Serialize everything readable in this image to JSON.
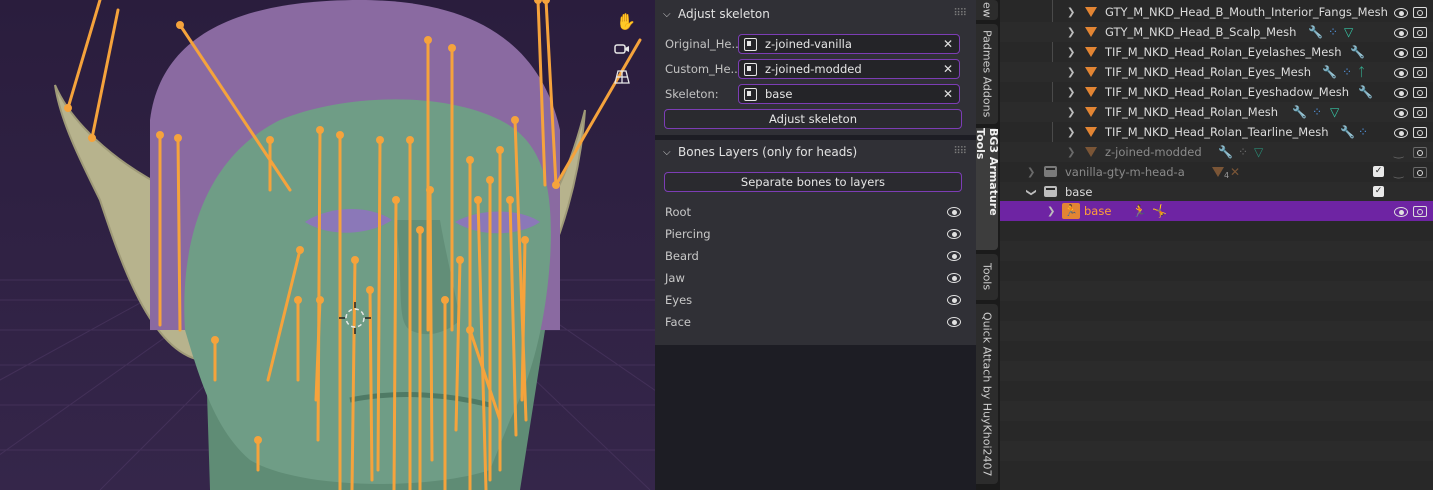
{
  "viewport": {
    "tools": [
      "hand-icon",
      "camera-icon",
      "grid-icon"
    ]
  },
  "npanel": {
    "adjust_skeleton": {
      "title": "Adjust skeleton",
      "original_label": "Original_He...",
      "original_value": "z-joined-vanilla",
      "custom_label": "Custom_He...",
      "custom_value": "z-joined-modded",
      "skeleton_label": "Skeleton:",
      "skeleton_value": "base",
      "button": "Adjust skeleton"
    },
    "bones_layers": {
      "title": "Bones Layers (only for heads)",
      "button": "Separate bones to layers",
      "layers": [
        "Root",
        "Piercing",
        "Beard",
        "Jaw",
        "Eyes",
        "Face"
      ]
    }
  },
  "vertical_tabs": {
    "top_cut": "ew",
    "padmes": "Padmes Addons",
    "bg3": "BG3 Armature Tools",
    "tools": "Tools",
    "quick_attach": "Quick Attach by HuyKhoi2407"
  },
  "outliner": {
    "meshes": [
      "GTY_M_NKD_Head_B_Mouth_Interior_Fangs_Mesh",
      "GTY_M_NKD_Head_B_Scalp_Mesh",
      "TIF_M_NKD_Head_Rolan_Eyelashes_Mesh",
      "TIF_M_NKD_Head_Rolan_Eyes_Mesh",
      "TIF_M_NKD_Head_Rolan_Eyeshadow_Mesh",
      "TIF_M_NKD_Head_Rolan_Mesh",
      "TIF_M_NKD_Head_Rolan_Tearline_Mesh"
    ],
    "dim_object": "z-joined-modded",
    "collection_1": "vanilla-gty-m-head-a",
    "collection_1_badge": "4",
    "collection_2": "base",
    "armature": "base"
  },
  "colors": {
    "accent": "#7c3db5",
    "selected_row": "#6e24a3",
    "bone": "#f5a33c",
    "mesh_icon": "#e38533",
    "skin": "#6f9d86",
    "scalp": "#8a6aa1"
  }
}
